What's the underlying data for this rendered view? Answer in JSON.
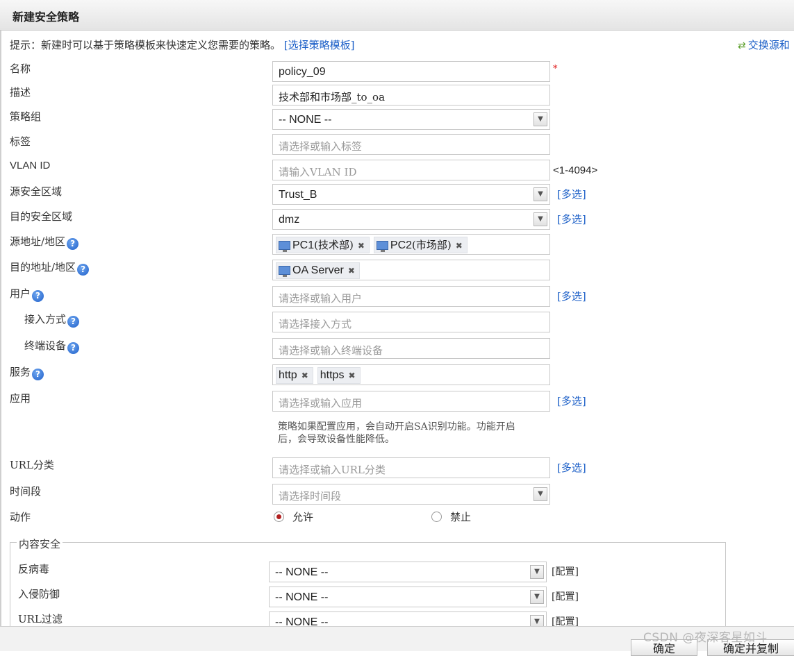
{
  "window": {
    "title": "新建安全策略"
  },
  "hint": {
    "text": "提示：新建时可以基于策略模板来快速定义您需要的策略。",
    "link": "[选择策略模板]"
  },
  "swap": {
    "label": "交换源和"
  },
  "form": {
    "name": {
      "label": "名称",
      "value": "policy_09",
      "required_mark": "*"
    },
    "desc": {
      "label": "描述",
      "value": "技术部和市场部_to_oa"
    },
    "group": {
      "label": "策略组",
      "value": "-- NONE --"
    },
    "tag": {
      "label": "标签",
      "placeholder": "请选择或输入标签"
    },
    "vlan": {
      "label": "VLAN ID",
      "placeholder": "请输入VLAN ID",
      "range": "<1-4094>"
    },
    "src_zone": {
      "label": "源安全区域",
      "value": "Trust_B",
      "multi": "[多选]"
    },
    "dst_zone": {
      "label": "目的安全区域",
      "value": "dmz",
      "multi": "[多选]"
    },
    "src_addr": {
      "label": "源地址/地区",
      "items": [
        {
          "name": "PC1",
          "paren": "(技术部)"
        },
        {
          "name": "PC2",
          "paren": "(市场部)"
        }
      ]
    },
    "dst_addr": {
      "label": "目的地址/地区",
      "items": [
        {
          "name": "OA Server"
        }
      ]
    },
    "user": {
      "label": "用户",
      "placeholder": "请选择或输入用户",
      "multi": "[多选]"
    },
    "access": {
      "label": "接入方式",
      "placeholder": "请选择接入方式"
    },
    "terminal": {
      "label": "终端设备",
      "placeholder": "请选择或输入终端设备"
    },
    "service": {
      "label": "服务",
      "items": [
        "http",
        "https"
      ]
    },
    "app": {
      "label": "应用",
      "placeholder": "请选择或输入应用",
      "multi": "[多选]",
      "note_line1": "策略如果配置应用，会自动开启SA识别功能。功能开启",
      "note_line2": "后，会导致设备性能降低。"
    },
    "url_cat": {
      "label": "URL分类",
      "placeholder": "请选择或输入URL分类",
      "multi": "[多选]"
    },
    "time": {
      "label": "时间段",
      "placeholder": "请选择时间段"
    },
    "action": {
      "label": "动作",
      "allow": "允许",
      "deny": "禁止",
      "selected": "allow"
    }
  },
  "content_security": {
    "legend": "内容安全",
    "rows": [
      {
        "label": "反病毒",
        "value": "-- NONE --",
        "config": "[配置]"
      },
      {
        "label": "入侵防御",
        "value": "-- NONE --",
        "config": "[配置]"
      },
      {
        "label": "URL过滤",
        "value": "-- NONE --",
        "config": "[配置]"
      }
    ]
  },
  "footer": {
    "ok": "确定",
    "ok_copy": "确定并复制"
  },
  "watermark": "CSDN @夜深客星如斗"
}
